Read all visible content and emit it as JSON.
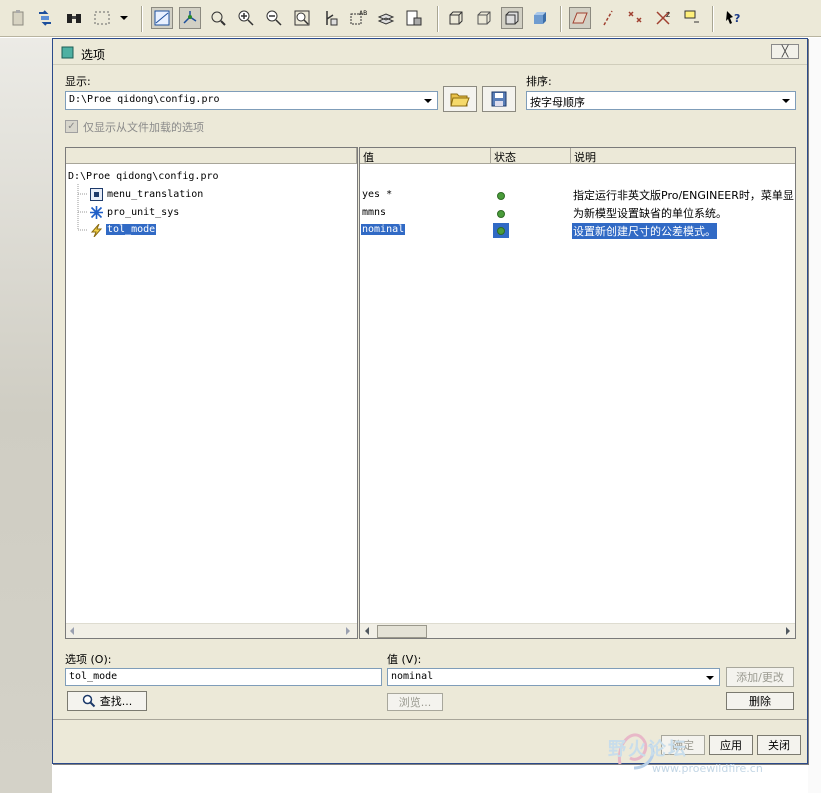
{
  "dialog": {
    "title": "选项",
    "close_label": "╳",
    "show_label": "显示:",
    "show_value": "D:\\Proe qidong\\config.pro",
    "sort_label": "排序:",
    "sort_value": "按字母顺序",
    "only_loaded_label": "仅显示从文件加载的选项",
    "only_loaded_checked": true,
    "tree_root": "D:\\Proe qidong\\config.pro",
    "columns": {
      "value": "值",
      "status": "状态",
      "description": "说明"
    },
    "rows": [
      {
        "name": "menu_translation",
        "icon": "menu-icon",
        "value": "yes *",
        "status": "active",
        "description": "指定运行非英文版Pro/ENGINEER时，菜单显",
        "selected": false
      },
      {
        "name": "pro_unit_sys",
        "icon": "star-icon",
        "value": "mmns",
        "status": "active",
        "description": "为新模型设置缺省的单位系统。",
        "selected": false
      },
      {
        "name": "tol_mode",
        "icon": "bolt-icon",
        "value": "nominal",
        "status": "active",
        "description": "设置新创建尺寸的公差模式。",
        "selected": true
      }
    ],
    "option_label": "选项 (O):",
    "option_value": "tol_mode",
    "value_label": "值 (V):",
    "value_value": "nominal",
    "find_label": "查找...",
    "browse_label": "浏览...",
    "add_change_label": "添加/更改",
    "delete_label": "删除",
    "ok_label": "确定",
    "apply_label": "应用",
    "close_button_label": "关闭"
  },
  "watermark": {
    "text": "野火论坛",
    "url": "www.proewildfire.cn"
  },
  "colors": {
    "selection": "#316ac5",
    "status_dot": "#4a9c3a",
    "dialog_bg": "#ece9d8"
  }
}
